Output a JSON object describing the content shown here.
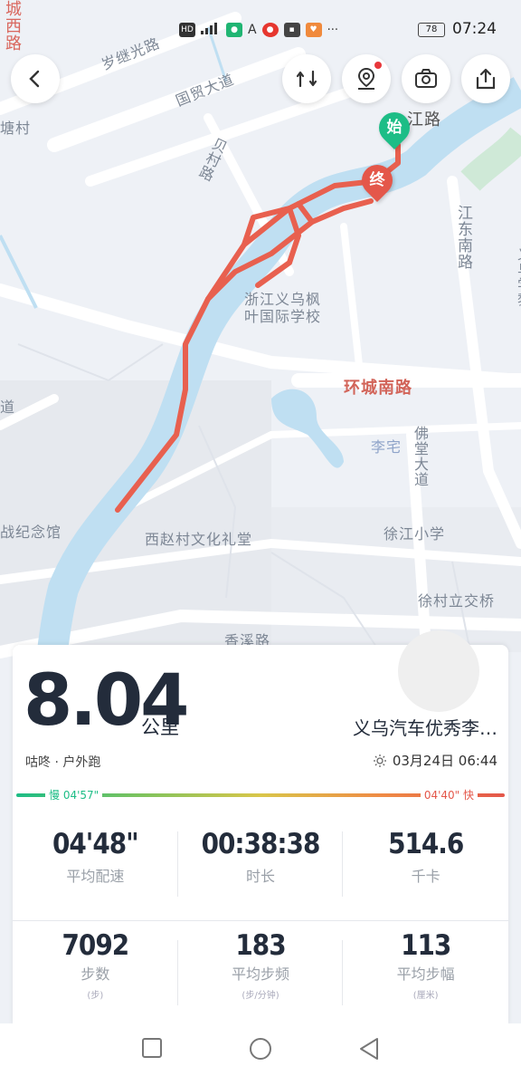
{
  "status_bar": {
    "time": "07:24",
    "battery": "78"
  },
  "map": {
    "labels": {
      "l1": "城西路",
      "l2": "岁继光路",
      "l3": "国贸大道",
      "l4": "塘村",
      "l5": "贝村路",
      "l6": "江路",
      "l7": "江东南路",
      "l8": "义乌学黎",
      "l9": "浙江义乌枫叶国际学校",
      "l10": "环城南路",
      "l11": "李宅",
      "l12": "佛堂大道",
      "l13": "徐江小学",
      "l14": "战纪念馆",
      "l15": "西赵村文化礼堂",
      "l16": "徐村立交桥",
      "l17": "香溪路",
      "l18": "道"
    },
    "start_pin": "始",
    "end_pin": "终"
  },
  "toolbar": {
    "back": "back-arrow-icon",
    "route": "route-toggle-icon",
    "location": "location-person-icon",
    "camera": "camera-icon",
    "share": "share-icon"
  },
  "summary": {
    "distance": "8.04",
    "distance_unit": "公里",
    "user_name": "义乌汽车优秀李…",
    "activity": "咕咚 · 户外跑",
    "datetime": "03月24日  06:44",
    "pace_slow": "慢 04'57\"",
    "pace_fast": "04'40\" 快"
  },
  "stats_row1": [
    {
      "value": "04'48\"",
      "label": "平均配速"
    },
    {
      "value": "00:38:38",
      "label": "时长"
    },
    {
      "value": "514.6",
      "label": "千卡"
    }
  ],
  "stats_row2": [
    {
      "value": "7092",
      "label": "步数",
      "sub": "(步)"
    },
    {
      "value": "183",
      "label": "平均步频",
      "sub": "(步/分钟)"
    },
    {
      "value": "113",
      "label": "平均步幅",
      "sub": "(厘米)"
    }
  ],
  "colors": {
    "route": "#e8604f",
    "river": "#bfdff2",
    "start": "#1dbd86",
    "end": "#e4574a"
  }
}
